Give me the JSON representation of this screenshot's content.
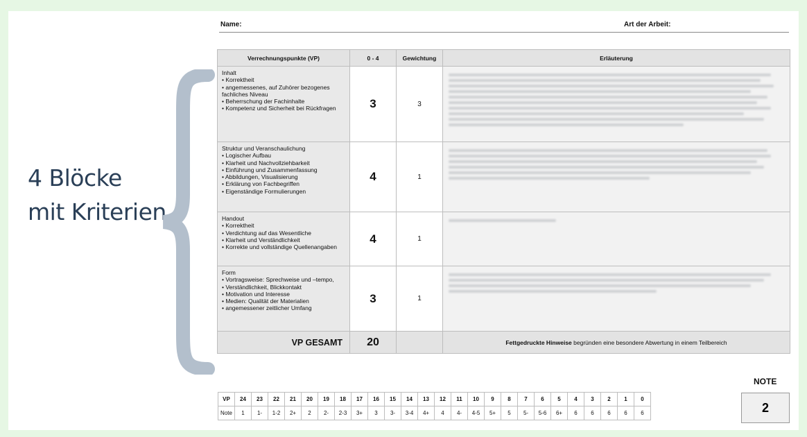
{
  "side_label": {
    "line1": "4 Blöcke",
    "line2": "mit Kriterien"
  },
  "header": {
    "name_label": "Name:",
    "art_label": "Art der Arbeit:"
  },
  "table": {
    "columns": [
      "Verrechnungspunkte (VP)",
      "0 - 4",
      "Gewichtung",
      "Erläuterung"
    ],
    "rows": [
      {
        "title": "Inhalt",
        "items": [
          "• Korrektheit",
          "• angemessenes, auf Zuhörer bezogenes fachliches Niveau",
          "• Beherrschung der Fachinhalte",
          "• Kompetenz und Sicherheit bei Rückfragen"
        ],
        "score": "3",
        "weight": "3"
      },
      {
        "title": "Struktur und Veranschaulichung",
        "items": [
          "• Logischer Aufbau",
          "• Klarheit und Nachvollziehbarkeit",
          "• Einführung und Zusammenfassung",
          "• Abbildungen, Visualisierung",
          "• Erklärung von Fachbegriffen",
          "• Eigenständige Formulierungen"
        ],
        "score": "4",
        "weight": "1"
      },
      {
        "title": "Handout",
        "items": [
          "• Korrektheit",
          "• Verdichtung auf das Wesentliche",
          "• Klarheit und Verständlichkeit",
          "• Korrekte und vollständige Quellenangaben"
        ],
        "score": "4",
        "weight": "1"
      },
      {
        "title": "Form",
        "items": [
          "• Vortragsweise: Sprechweise und –tempo,",
          "• Verständlichkeit, Blickkontakt",
          "• Motivation und Interesse",
          "• Medien: Qualität der Materialien",
          "• angemessener zeitlicher Umfang"
        ],
        "score": "3",
        "weight": "1"
      }
    ],
    "total_label": "VP GESAMT",
    "total_value": "20",
    "note_bold": "Fettgedruckte Hinweise",
    "note_rest": " begründen eine besondere Abwertung in einem Teilbereich"
  },
  "scale": {
    "vp_label": "VP",
    "note_label": "Note",
    "vp": [
      "24",
      "23",
      "22",
      "21",
      "20",
      "19",
      "18",
      "17",
      "16",
      "15",
      "14",
      "13",
      "12",
      "11",
      "10",
      "9",
      "8",
      "7",
      "6",
      "5",
      "4",
      "3",
      "2",
      "1",
      "0"
    ],
    "note": [
      "1",
      "1-",
      "1-2",
      "2+",
      "2",
      "2-",
      "2-3",
      "3+",
      "3",
      "3-",
      "3-4",
      "4+",
      "4",
      "4-",
      "4-5",
      "5+",
      "5",
      "5-",
      "5-6",
      "6+",
      "6",
      "6",
      "6",
      "6",
      "6"
    ]
  },
  "grade": {
    "label": "NOTE",
    "value": "2"
  }
}
